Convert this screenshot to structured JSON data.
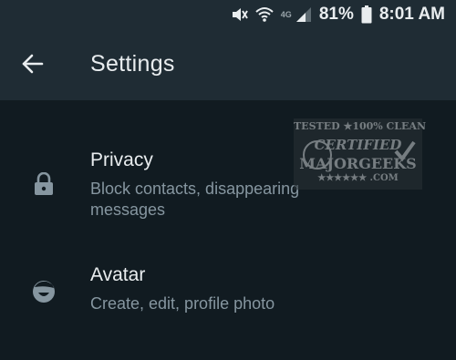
{
  "status_bar": {
    "network": "4G",
    "battery": "81%",
    "time": "8:01 AM",
    "icons": [
      "mute-icon",
      "wifi-icon",
      "signal-icon",
      "battery-icon"
    ]
  },
  "header": {
    "back_icon": "arrow-left-icon",
    "title": "Settings"
  },
  "settings_items": [
    {
      "icon": "lock-icon",
      "title": "Privacy",
      "subtitle": "Block contacts, disappearing messages"
    },
    {
      "icon": "avatar-icon",
      "title": "Avatar",
      "subtitle": "Create, edit, profile photo"
    }
  ],
  "watermark": {
    "top": "TESTED ★100% CLEAN",
    "middle": "CERTIFIED",
    "brand": "MAJORGEEKS",
    "bottom": "★★★★★★ .COM"
  },
  "colors": {
    "background": "#111b21",
    "header": "#1f2c34",
    "text_primary": "#e9edef",
    "text_secondary": "#8696a0",
    "icon": "#8696a0"
  }
}
